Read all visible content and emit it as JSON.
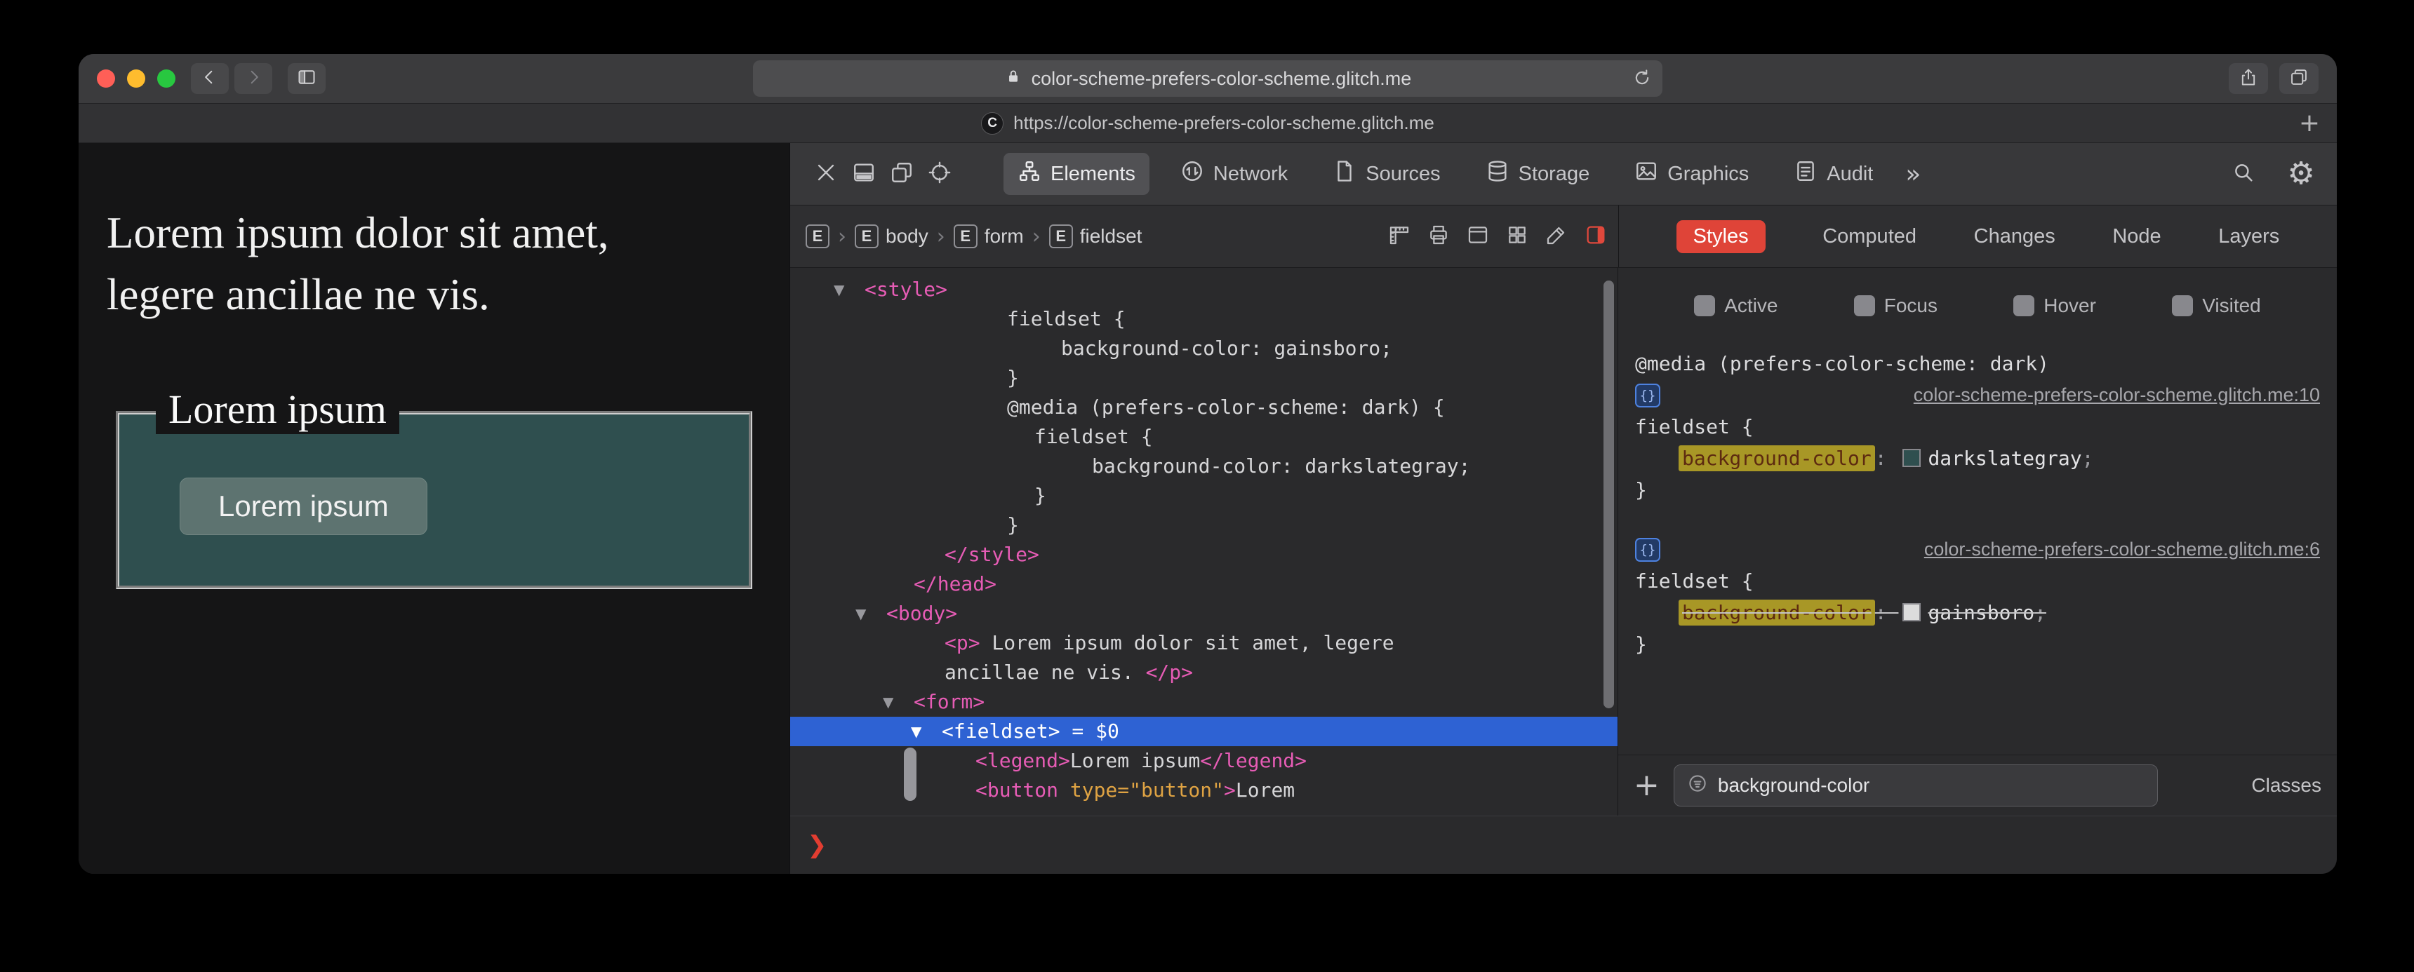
{
  "colors": {
    "selection_blue": "#2e62d3",
    "tag_pink": "#e65cb5",
    "attr_orange": "#dfa343",
    "search_highlight": "#a89726",
    "styles_tab_red": "#df4438",
    "page_background": "#151516",
    "fieldset_background": "#2f4f4f",
    "button_background": "#5d7370",
    "darkslategray_swatch": "#2f4f4f",
    "gainsboro_swatch": "#dcdcdc"
  },
  "window": {
    "titlebar": {
      "url": "color-scheme-prefers-color-scheme.glitch.me"
    },
    "tab": {
      "favicon_letter": "C",
      "title": "https://color-scheme-prefers-color-scheme.glitch.me",
      "new_tab_label": "+"
    }
  },
  "page": {
    "paragraph": "Lorem ipsum dolor sit amet, legere ancillae ne vis.",
    "fieldset_legend": "Lorem ipsum",
    "button_label": "Lorem ipsum"
  },
  "inspector": {
    "toolbar": {
      "tabs": [
        {
          "label": "Elements",
          "icon": "elements-icon",
          "selected": true
        },
        {
          "label": "Network",
          "icon": "network-icon",
          "selected": false
        },
        {
          "label": "Sources",
          "icon": "sources-icon",
          "selected": false
        },
        {
          "label": "Storage",
          "icon": "storage-icon",
          "selected": false
        },
        {
          "label": "Graphics",
          "icon": "graphics-icon",
          "selected": false
        },
        {
          "label": "Audit",
          "icon": "audit-icon",
          "selected": false
        }
      ],
      "overflow_label": "»"
    },
    "breadcrumb": [
      {
        "icon_letter": "E",
        "label": ""
      },
      {
        "icon_letter": "E",
        "label": "body"
      },
      {
        "icon_letter": "E",
        "label": "form"
      },
      {
        "icon_letter": "E",
        "label": "fieldset"
      }
    ],
    "sidebar_tabs": [
      {
        "label": "Styles",
        "selected": true
      },
      {
        "label": "Computed",
        "selected": false
      },
      {
        "label": "Changes",
        "selected": false
      },
      {
        "label": "Node",
        "selected": false
      },
      {
        "label": "Layers",
        "selected": false
      }
    ],
    "dom_tree": {
      "lines": [
        {
          "indent": 106,
          "tri": true,
          "seg": [
            [
              "tag",
              "<style>"
            ]
          ]
        },
        {
          "indent": 309,
          "seg": [
            [
              "css",
              "fieldset {"
            ]
          ]
        },
        {
          "indent": 386,
          "seg": [
            [
              "css",
              "background-color: gainsboro;"
            ]
          ]
        },
        {
          "indent": 309,
          "seg": [
            [
              "css",
              "}"
            ]
          ]
        },
        {
          "indent": 309,
          "seg": [
            [
              "css",
              "@media (prefers-color-scheme: dark) {"
            ]
          ]
        },
        {
          "indent": 348,
          "seg": [
            [
              "css",
              "fieldset {"
            ]
          ]
        },
        {
          "indent": 430,
          "seg": [
            [
              "css",
              "background-color: darkslategray;"
            ]
          ]
        },
        {
          "indent": 348,
          "seg": [
            [
              "css",
              "}"
            ]
          ]
        },
        {
          "indent": 309,
          "seg": [
            [
              "css",
              "}"
            ]
          ]
        },
        {
          "indent": 220,
          "seg": [
            [
              "tag",
              "</style>"
            ]
          ]
        },
        {
          "indent": 176,
          "seg": [
            [
              "tag",
              "</head>"
            ]
          ]
        },
        {
          "indent": 137,
          "tri": true,
          "seg": [
            [
              "tag",
              "<body>"
            ]
          ]
        },
        {
          "indent": 220,
          "seg": [
            [
              "tag",
              "<p>"
            ],
            [
              "text",
              " Lorem ipsum dolor sit amet, legere"
            ]
          ]
        },
        {
          "indent": 220,
          "seg": [
            [
              "text",
              "ancillae ne vis. "
            ],
            [
              "tag",
              "</p>"
            ]
          ]
        },
        {
          "indent": 176,
          "tri": true,
          "seg": [
            [
              "tag",
              "<form>"
            ]
          ]
        },
        {
          "indent": 216,
          "tri": true,
          "selected": true,
          "seg": [
            [
              "tag",
              "<fieldset>"
            ],
            [
              "text",
              " = $0"
            ]
          ]
        },
        {
          "indent": 264,
          "seg": [
            [
              "tag",
              "<legend>"
            ],
            [
              "text",
              "Lorem ipsum"
            ],
            [
              "tag",
              "</legend>"
            ]
          ]
        },
        {
          "indent": 264,
          "seg": [
            [
              "tag",
              "<button "
            ],
            [
              "attr",
              "type=\"button\""
            ],
            [
              "tag",
              ">"
            ],
            [
              "text",
              "Lorem"
            ]
          ]
        }
      ]
    },
    "styles_panel": {
      "pseudo_toggles": [
        "Active",
        "Focus",
        "Hover",
        "Visited"
      ],
      "rules": [
        {
          "media": "@media (prefers-color-scheme: dark)",
          "link": "color-scheme-prefers-color-scheme.glitch.me:10",
          "selector": "fieldset {",
          "declarations": [
            {
              "property": "background-color",
              "value": "darkslategray",
              "swatch": "#2f4f4f",
              "highlighted": true,
              "struck": false
            }
          ],
          "close": "}"
        },
        {
          "media": "",
          "link": "color-scheme-prefers-color-scheme.glitch.me:6",
          "selector": "fieldset {",
          "declarations": [
            {
              "property": "background-color",
              "value": "gainsboro",
              "swatch": "#dcdcdc",
              "highlighted": true,
              "struck": true
            }
          ],
          "close": "}"
        }
      ],
      "filter_value": "background-color",
      "classes_label": "Classes"
    },
    "console": {
      "prompt_char": "❯"
    }
  }
}
